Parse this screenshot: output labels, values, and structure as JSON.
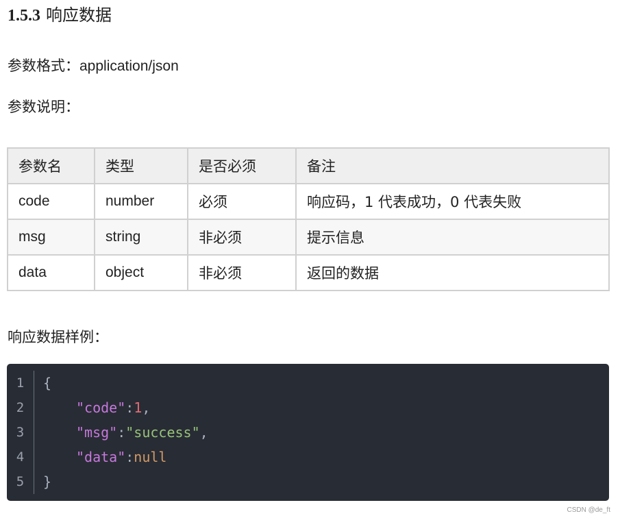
{
  "section": {
    "number": "1.5.3",
    "title": "响应数据"
  },
  "format": {
    "label": "参数格式：",
    "value": "application/json"
  },
  "description_label": "参数说明：",
  "table": {
    "headers": [
      "参数名",
      "类型",
      "是否必须",
      "备注"
    ],
    "rows": [
      [
        "code",
        "number",
        "必须",
        "响应码，1 代表成功，0 代表失败"
      ],
      [
        "msg",
        "string",
        "非必须",
        "提示信息"
      ],
      [
        "data",
        "object",
        "非必须",
        "返回的数据"
      ]
    ]
  },
  "sample_label": "响应数据样例：",
  "code_sample": {
    "line_numbers": [
      "1",
      "2",
      "3",
      "4",
      "5"
    ],
    "open_brace": "{",
    "close_brace": "}",
    "entries": [
      {
        "key": "\"code\"",
        "colon": ":",
        "value": "1",
        "trail": ","
      },
      {
        "key": "\"msg\"",
        "colon": ":",
        "value": "\"success\"",
        "trail": ","
      },
      {
        "key": "\"data\"",
        "colon": ":",
        "value": "null",
        "trail": ""
      }
    ]
  },
  "watermark": "CSDN @de_ft",
  "colors": {
    "code_background": "#282c34",
    "json_key": "#c678dd",
    "json_string": "#98c379",
    "json_number": "#e06c75",
    "json_null": "#d19a66",
    "table_header_bg": "#efefef",
    "table_border": "#d0d0d0"
  }
}
